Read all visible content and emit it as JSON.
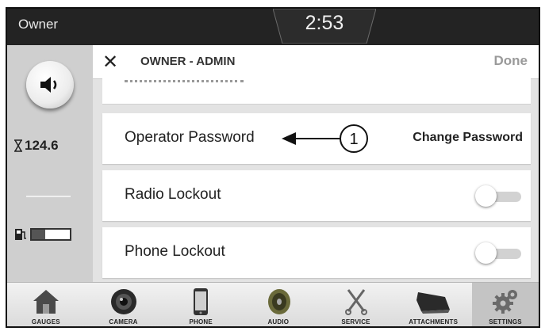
{
  "status_bar": {
    "profile": "Owner",
    "time": "2:53"
  },
  "left_panel": {
    "hour_meter": "124.6",
    "fuel_level": 0.35
  },
  "header": {
    "title": "OWNER - ADMIN",
    "done_label": "Done"
  },
  "settings_rows": [
    {
      "label": "Operator Password",
      "action_label": "Change Password",
      "callout": "1"
    },
    {
      "label": "Radio Lockout",
      "toggle_on": false
    },
    {
      "label": "Phone Lockout",
      "toggle_on": false
    }
  ],
  "tabs": [
    {
      "label": "GAUGES",
      "icon": "house-icon"
    },
    {
      "label": "CAMERA",
      "icon": "camera-icon"
    },
    {
      "label": "PHONE",
      "icon": "phone-icon"
    },
    {
      "label": "AUDIO",
      "icon": "speaker-icon"
    },
    {
      "label": "SERVICE",
      "icon": "tools-icon"
    },
    {
      "label": "ATTACHMENTS",
      "icon": "bucket-icon"
    },
    {
      "label": "SETTINGS",
      "icon": "gear-icon",
      "active": true
    }
  ]
}
